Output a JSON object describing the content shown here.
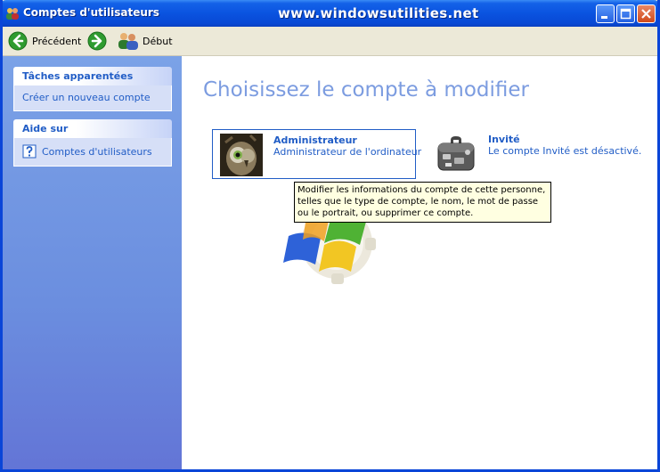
{
  "window": {
    "title": "Comptes d'utilisateurs",
    "watermark": "www.windowsutilities.net"
  },
  "toolbar": {
    "back_label": "Précédent",
    "home_label": "Début"
  },
  "sidebar": {
    "related_tasks": {
      "header": "Tâches apparentées",
      "items": [
        "Créer un nouveau compte"
      ]
    },
    "help": {
      "header": "Aide sur",
      "items": [
        "Comptes d'utilisateurs"
      ]
    }
  },
  "main": {
    "heading": "Choisissez le compte à modifier",
    "accounts": [
      {
        "name": "Administrateur",
        "description": "Administrateur de l'ordinateur",
        "picture": "eagle-owl-picture"
      },
      {
        "name": "Invité",
        "description": "Le compte Invité est désactivé.",
        "picture": "briefcase-picture"
      }
    ],
    "tooltip": "Modifier les informations du compte de cette personne, telles que le type de compte, le nom, le mot de passe ou le portrait, ou supprimer ce compte."
  },
  "colors": {
    "title_bar": "#0a53e0",
    "link_blue": "#215dc6",
    "heading_blue": "#7c9ce0",
    "sidebar_blue": "#6b8edf",
    "tooltip_bg": "#ffffe1"
  }
}
